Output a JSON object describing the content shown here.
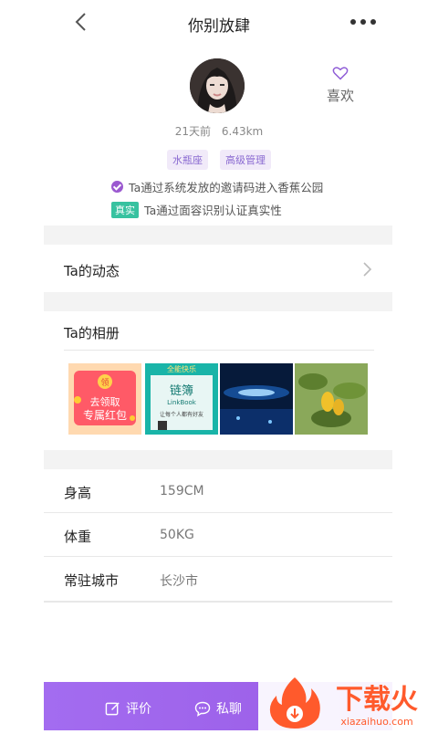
{
  "header": {
    "title": "你别放肆"
  },
  "profile": {
    "like_label": "喜欢",
    "last_active": "21天前",
    "distance": "6.43km",
    "tags": [
      "水瓶座",
      "高级管理"
    ],
    "verify_invite": "Ta通过系统发放的邀请码进入香蕉公园",
    "real_badge": "真实",
    "verify_face": "Ta通过面容识别认证真实性"
  },
  "sections": {
    "dynamics_label": "Ta的动态",
    "album_title": "Ta的相册"
  },
  "album": {
    "thumb1": {
      "badge": "领",
      "line1": "去领取",
      "line2": "专属红包"
    },
    "thumb2": {
      "top": "全能快乐",
      "title": "链簿",
      "sub": "LinkBook",
      "note": "让每个人都有好友"
    }
  },
  "info": [
    {
      "label": "身高",
      "value": "159CM"
    },
    {
      "label": "体重",
      "value": "50KG"
    },
    {
      "label": "常驻城市",
      "value": "长沙市"
    }
  ],
  "bottom": {
    "review_label": "评价",
    "chat_label": "私聊"
  },
  "watermark": {
    "brand": "下载火",
    "url": "xiazaihuo.com"
  },
  "colors": {
    "accent": "#9a5ce6",
    "real_badge": "#37c2a0"
  }
}
